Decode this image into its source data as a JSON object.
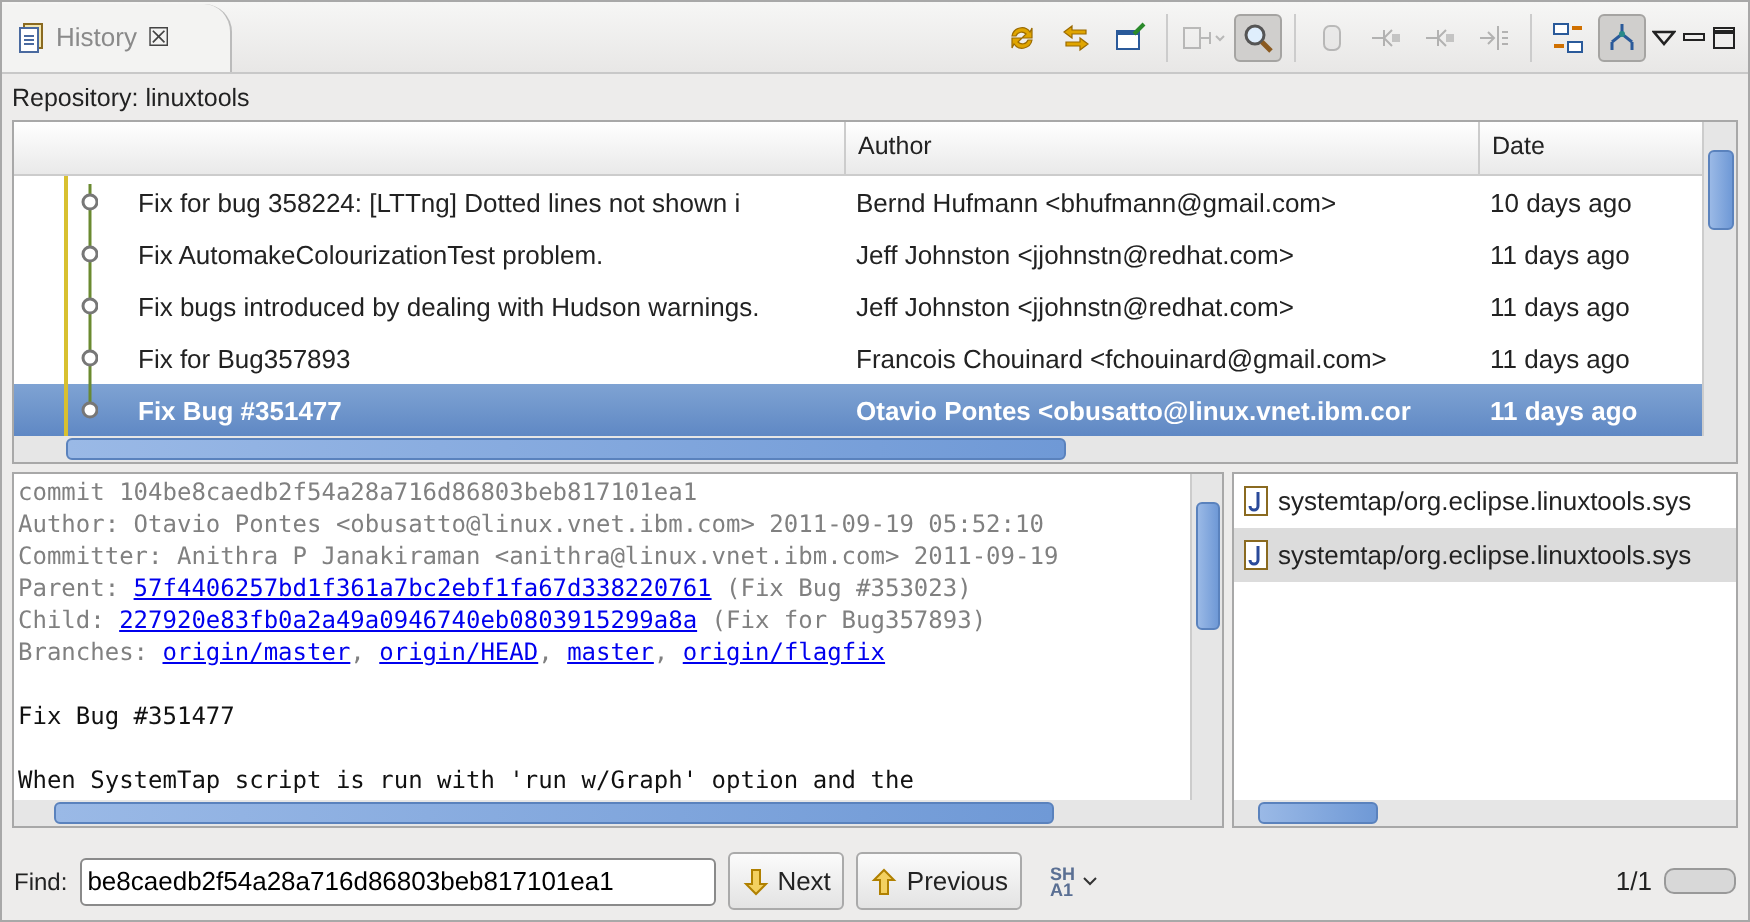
{
  "view_tab": {
    "title": "History",
    "close": "☒"
  },
  "toolbar": [
    {
      "kind": "sync",
      "pressed": false,
      "disabled": false
    },
    {
      "kind": "compare",
      "pressed": false,
      "disabled": false
    },
    {
      "kind": "pin",
      "pressed": false,
      "disabled": false
    },
    {
      "kind": "sep"
    },
    {
      "kind": "filter",
      "pressed": false,
      "disabled": true
    },
    {
      "kind": "search",
      "pressed": true,
      "disabled": false
    },
    {
      "kind": "sep"
    },
    {
      "kind": "cylinder",
      "pressed": false,
      "disabled": true
    },
    {
      "kind": "branch",
      "pressed": false,
      "disabled": true
    },
    {
      "kind": "branch",
      "pressed": false,
      "disabled": true
    },
    {
      "kind": "split",
      "pressed": false,
      "disabled": true
    },
    {
      "kind": "sep"
    },
    {
      "kind": "layout",
      "pressed": false,
      "disabled": false
    },
    {
      "kind": "tree",
      "pressed": true,
      "disabled": false
    },
    {
      "kind": "menu"
    },
    {
      "kind": "minimize"
    },
    {
      "kind": "maximize"
    }
  ],
  "repository": "Repository: linuxtools",
  "table": {
    "columns": [
      "Author",
      "Date"
    ],
    "rows": [
      {
        "message": "Fix for bug 358224: [LTTng] Dotted lines not shown i",
        "author": "Bernd Hufmann <bhufmann@gmail.com>",
        "date": "10 days ago",
        "selected": false
      },
      {
        "message": "Fix AutomakeColourizationTest problem.",
        "author": "Jeff Johnston <jjohnstn@redhat.com>",
        "date": "11 days ago",
        "selected": false
      },
      {
        "message": "Fix bugs introduced by dealing with Hudson warnings.",
        "author": "Jeff Johnston <jjohnstn@redhat.com>",
        "date": "11 days ago",
        "selected": false
      },
      {
        "message": "Fix for Bug357893",
        "author": "Francois Chouinard <fchouinard@gmail.com>",
        "date": "11 days ago",
        "selected": false
      },
      {
        "message": "Fix Bug #351477",
        "author": "Otavio Pontes <obusatto@linux.vnet.ibm.cor",
        "date": "11 days ago",
        "selected": true
      }
    ]
  },
  "details": [
    {
      "kind": "header",
      "parts": [
        {
          "text": "commit 104be8caedb2f54a28a716d86803beb817101ea1",
          "link": false
        }
      ]
    },
    {
      "kind": "header",
      "parts": [
        {
          "text": "Author: Otavio Pontes <obusatto@linux.vnet.ibm.com> 2011-09-19 05:52:10",
          "link": false
        }
      ]
    },
    {
      "kind": "header",
      "parts": [
        {
          "text": "Committer: Anithra P Janakiraman <anithra@linux.vnet.ibm.com> 2011-09-19",
          "link": false
        }
      ]
    },
    {
      "kind": "header",
      "parts": [
        {
          "text": "Parent: ",
          "link": false
        },
        {
          "text": "57f4406257bd1f361a7bc2ebf1fa67d338220761",
          "link": true
        },
        {
          "text": " (Fix Bug #353023)",
          "link": false
        }
      ]
    },
    {
      "kind": "header",
      "parts": [
        {
          "text": "Child: ",
          "link": false
        },
        {
          "text": "227920e83fb0a2a49a0946740eb0803915299a8a",
          "link": true
        },
        {
          "text": " (Fix for Bug357893)",
          "link": false
        }
      ]
    },
    {
      "kind": "header",
      "parts": [
        {
          "text": "Branches: ",
          "link": false
        },
        {
          "text": "origin/master",
          "link": true
        },
        {
          "text": ", ",
          "link": false
        },
        {
          "text": "origin/HEAD",
          "link": true
        },
        {
          "text": ", ",
          "link": false
        },
        {
          "text": "master",
          "link": true
        },
        {
          "text": ", ",
          "link": false
        },
        {
          "text": "origin/flagfix",
          "link": true
        }
      ]
    },
    {
      "kind": "blank"
    },
    {
      "kind": "message",
      "parts": [
        {
          "text": "Fix Bug #351477",
          "link": false
        }
      ]
    },
    {
      "kind": "blank"
    },
    {
      "kind": "message",
      "parts": [
        {
          "text": "When SystemTap script is run with 'run w/Graph' option and the",
          "link": false
        }
      ]
    }
  ],
  "files": [
    {
      "path": "systemtap/org.eclipse.linuxtools.sys",
      "selected": false
    },
    {
      "path": "systemtap/org.eclipse.linuxtools.sys",
      "selected": true
    }
  ],
  "find": {
    "label": "Find:",
    "value": "be8caedb2f54a28a716d86803beb817101ea1",
    "next": "Next",
    "previous": "Previous",
    "mode": "SHA1",
    "count": "1/1"
  }
}
